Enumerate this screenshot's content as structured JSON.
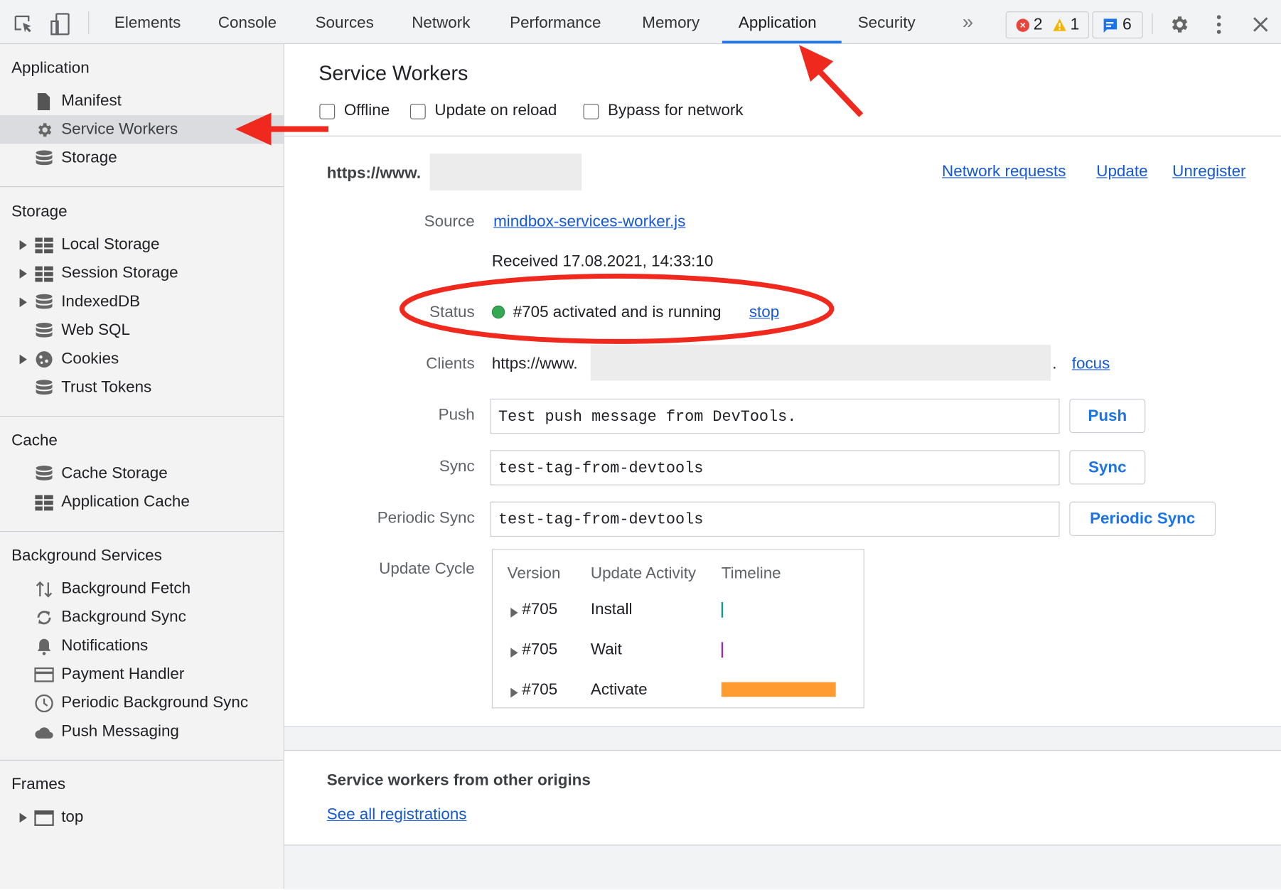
{
  "toolbar": {
    "tabs": [
      "Elements",
      "Console",
      "Sources",
      "Network",
      "Performance",
      "Memory",
      "Application",
      "Security"
    ],
    "active_tab": "Application",
    "more_icon": "chevron-double-right-icon",
    "errors": "2",
    "warnings": "1",
    "messages": "6",
    "icons": [
      "inspect-element-icon",
      "device-toolbar-icon",
      "settings-gear-icon",
      "kebab-menu-icon",
      "close-icon"
    ],
    "accent": "#1a73e8"
  },
  "sidebar": {
    "sections": [
      {
        "title": "Application",
        "items": [
          {
            "label": "Manifest",
            "icon": "file-icon"
          },
          {
            "label": "Service Workers",
            "icon": "gear-icon",
            "selected": true
          },
          {
            "label": "Storage",
            "icon": "database-icon"
          }
        ]
      },
      {
        "title": "Storage",
        "items": [
          {
            "label": "Local Storage",
            "icon": "grid-icon",
            "expandable": true
          },
          {
            "label": "Session Storage",
            "icon": "grid-icon",
            "expandable": true
          },
          {
            "label": "IndexedDB",
            "icon": "database-icon",
            "expandable": true
          },
          {
            "label": "Web SQL",
            "icon": "database-icon"
          },
          {
            "label": "Cookies",
            "icon": "cookie-icon",
            "expandable": true
          },
          {
            "label": "Trust Tokens",
            "icon": "database-icon"
          }
        ]
      },
      {
        "title": "Cache",
        "items": [
          {
            "label": "Cache Storage",
            "icon": "database-icon"
          },
          {
            "label": "Application Cache",
            "icon": "grid-icon"
          }
        ]
      },
      {
        "title": "Background Services",
        "items": [
          {
            "label": "Background Fetch",
            "icon": "arrows-up-down-icon"
          },
          {
            "label": "Background Sync",
            "icon": "sync-icon"
          },
          {
            "label": "Notifications",
            "icon": "bell-icon"
          },
          {
            "label": "Payment Handler",
            "icon": "credit-card-icon"
          },
          {
            "label": "Periodic Background Sync",
            "icon": "clock-icon"
          },
          {
            "label": "Push Messaging",
            "icon": "cloud-icon"
          }
        ]
      },
      {
        "title": "Frames",
        "items": [
          {
            "label": "top",
            "icon": "frame-icon",
            "expandable": true
          }
        ]
      }
    ]
  },
  "main": {
    "title": "Service Workers",
    "options": [
      "Offline",
      "Update on reload",
      "Bypass for network"
    ],
    "origin": "https://www.",
    "actions": [
      "Network requests",
      "Update",
      "Unregister"
    ],
    "source_label": "Source",
    "source_link": "mindbox-services-worker.js",
    "received": "Received 17.08.2021, 14:33:10",
    "status_label": "Status",
    "status_text": "#705 activated and is running",
    "status_color": "#34a853",
    "status_action": "stop",
    "clients_label": "Clients",
    "clients_value": "https://www.",
    "clients_suffix": ".",
    "clients_action": "focus",
    "push_label": "Push",
    "push_value": "Test push message from DevTools.",
    "push_button": "Push",
    "sync_label": "Sync",
    "sync_value": "test-tag-from-devtools",
    "sync_button": "Sync",
    "periodic_label": "Periodic Sync",
    "periodic_value": "test-tag-from-devtools",
    "periodic_button": "Periodic Sync",
    "cycle_label": "Update Cycle",
    "cycle_headers": [
      "Version",
      "Update Activity",
      "Timeline"
    ],
    "cycle_rows": [
      {
        "version": "#705",
        "activity": "Install",
        "color": "#0f9d8f"
      },
      {
        "version": "#705",
        "activity": "Wait",
        "color": "#9c27b0"
      },
      {
        "version": "#705",
        "activity": "Activate",
        "color": "#ff9b31"
      }
    ],
    "other_title": "Service workers from other origins",
    "other_link": "See all registrations"
  },
  "annotations": {
    "color": "#f0291f"
  }
}
